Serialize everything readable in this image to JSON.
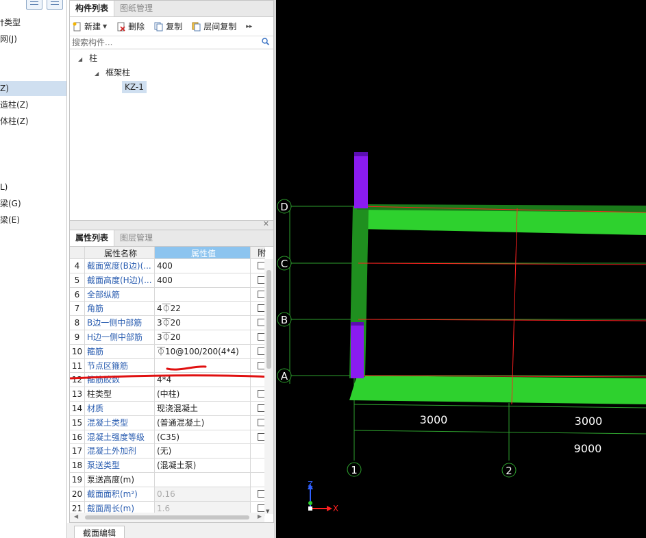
{
  "left_tree": {
    "items": [
      {
        "label": "†类型",
        "selected": false
      },
      {
        "label": "网(J)",
        "selected": false
      },
      {
        "label": "Z)",
        "selected": true
      },
      {
        "label": "造柱(Z)",
        "selected": false
      },
      {
        "label": "体柱(Z)",
        "selected": false
      },
      {
        "label": "L)",
        "selected": false
      },
      {
        "label": "梁(G)",
        "selected": false
      },
      {
        "label": "梁(E)",
        "selected": false
      }
    ]
  },
  "component_panel": {
    "tabs": [
      "构件列表",
      "图纸管理"
    ],
    "toolbar": {
      "new_label": "新建",
      "delete_label": "删除",
      "copy_label": "复制",
      "floor_copy_label": "层间复制",
      "more_label": "▸▸"
    },
    "search_placeholder": "搜索构件...",
    "tree": {
      "root": "柱",
      "child": "框架柱",
      "leaf": "KZ-1"
    }
  },
  "property_panel": {
    "tabs": [
      "属性列表",
      "图层管理"
    ],
    "headers": {
      "name": "属性名称",
      "value": "属性值",
      "attach": "附"
    },
    "rows": [
      {
        "num": "4",
        "name": "截面宽度(B边)(...",
        "value": "400",
        "blue": true,
        "check": true,
        "gray": false
      },
      {
        "num": "5",
        "name": "截面高度(H边)(...",
        "value": "400",
        "blue": true,
        "check": true,
        "gray": false
      },
      {
        "num": "6",
        "name": "全部纵筋",
        "value": "",
        "blue": true,
        "check": true,
        "gray": false
      },
      {
        "num": "7",
        "name": "角筋",
        "value": "4⏁22",
        "blue": true,
        "check": true,
        "gray": false
      },
      {
        "num": "8",
        "name": "B边一侧中部筋",
        "value": "3⏁20",
        "blue": true,
        "check": true,
        "gray": false
      },
      {
        "num": "9",
        "name": "H边一侧中部筋",
        "value": "3⏁20",
        "blue": true,
        "check": true,
        "gray": false
      },
      {
        "num": "10",
        "name": "箍筋",
        "value": "⏁10@100/200(4*4)",
        "blue": true,
        "check": true,
        "gray": false
      },
      {
        "num": "11",
        "name": "节点区箍筋",
        "value": "",
        "blue": true,
        "check": true,
        "gray": false
      },
      {
        "num": "12",
        "name": "箍筋胶数",
        "value": "4*4",
        "blue": true,
        "check": false,
        "gray": false
      },
      {
        "num": "13",
        "name": "柱类型",
        "value": "(中柱)",
        "blue": false,
        "check": true,
        "gray": false
      },
      {
        "num": "14",
        "name": "材质",
        "value": "现浇混凝土",
        "blue": true,
        "check": true,
        "gray": false
      },
      {
        "num": "15",
        "name": "混凝土类型",
        "value": "(普通混凝土)",
        "blue": true,
        "check": true,
        "gray": false
      },
      {
        "num": "16",
        "name": "混凝土强度等级",
        "value": "(C35)",
        "blue": true,
        "check": true,
        "gray": false
      },
      {
        "num": "17",
        "name": "混凝土外加剂",
        "value": "(无)",
        "blue": true,
        "check": false,
        "gray": false
      },
      {
        "num": "18",
        "name": "泵送类型",
        "value": "(混凝土泵)",
        "blue": true,
        "check": false,
        "gray": false
      },
      {
        "num": "19",
        "name": "泵送高度(m)",
        "value": "",
        "blue": false,
        "check": false,
        "gray": false
      },
      {
        "num": "20",
        "name": "截面面积(m²)",
        "value": "0.16",
        "blue": true,
        "check": true,
        "gray": true
      },
      {
        "num": "21",
        "name": "截面周长(m)",
        "value": "1.6",
        "blue": true,
        "check": true,
        "gray": true
      }
    ]
  },
  "bottom_tab": "截面编辑",
  "viewport": {
    "axes_rows": [
      "D",
      "C",
      "B",
      "A"
    ],
    "axes_cols": [
      "1",
      "2"
    ],
    "dims": {
      "span1": "3000",
      "span2": "3000",
      "total": "9000"
    },
    "coord_labels": {
      "z": "Z",
      "x": "X"
    },
    "colors": {
      "beam": "#2ed12e",
      "column": "#8a1bf0",
      "grid": "#ff2020",
      "axis": "#2ea12e",
      "background": "#000000"
    }
  }
}
